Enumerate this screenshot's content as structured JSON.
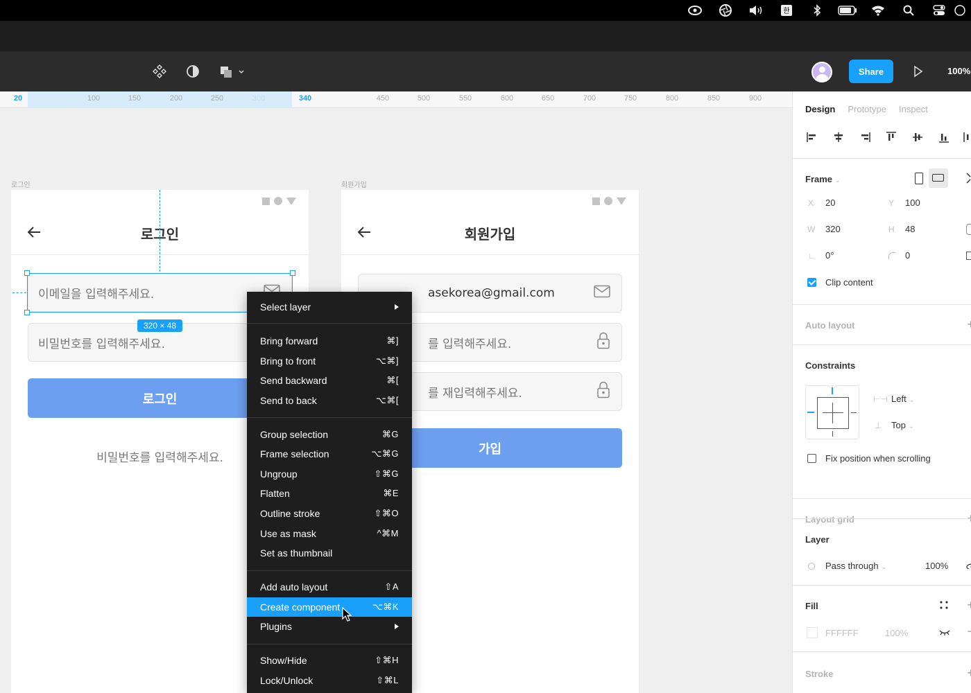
{
  "toolbar": {
    "share_label": "Share",
    "zoom": "100%"
  },
  "ruler": {
    "ticks": [
      {
        "label": "20",
        "style": "blue"
      },
      {
        "label": "100",
        "style": "normal"
      },
      {
        "label": "150",
        "style": "normal"
      },
      {
        "label": "200",
        "style": "normal"
      },
      {
        "label": "250",
        "style": "normal"
      },
      {
        "label": "300",
        "style": "faint"
      },
      {
        "label": "340",
        "style": "blue"
      },
      {
        "label": "450",
        "style": "normal"
      },
      {
        "label": "500",
        "style": "normal"
      },
      {
        "label": "550",
        "style": "normal"
      },
      {
        "label": "600",
        "style": "normal"
      },
      {
        "label": "650",
        "style": "normal"
      },
      {
        "label": "700",
        "style": "normal"
      },
      {
        "label": "750",
        "style": "normal"
      },
      {
        "label": "800",
        "style": "normal"
      },
      {
        "label": "850",
        "style": "normal"
      },
      {
        "label": "900",
        "style": "normal"
      }
    ]
  },
  "login_frame": {
    "label": "로그인",
    "title": "로그인",
    "email_placeholder": "이메일을 입력해주세요.",
    "password_placeholder": "비밀번호를 입력해주세요.",
    "button": "로그인",
    "helper": "비밀번호를 입력해주세요."
  },
  "signup_frame": {
    "label": "회원가입",
    "title": "회원가입",
    "email_value": "asekorea@gmail.com",
    "password_placeholder": "를 입력해주세요.",
    "password_confirm_placeholder": "를 재입력해주세요.",
    "button": "가입"
  },
  "selection": {
    "size": "320 × 48"
  },
  "context_menu": {
    "select_layer": "Select layer",
    "items": [
      {
        "label": "Bring forward",
        "shortcut": "⌘]"
      },
      {
        "label": "Bring to front",
        "shortcut": "⌥⌘]"
      },
      {
        "label": "Send backward",
        "shortcut": "⌘["
      },
      {
        "label": "Send to back",
        "shortcut": "⌥⌘["
      },
      {
        "label": "Group selection",
        "shortcut": "⌘G"
      },
      {
        "label": "Frame selection",
        "shortcut": "⌥⌘G"
      },
      {
        "label": "Ungroup",
        "shortcut": "⇧⌘G"
      },
      {
        "label": "Flatten",
        "shortcut": "⌘E"
      },
      {
        "label": "Outline stroke",
        "shortcut": "⇧⌘O"
      },
      {
        "label": "Use as mask",
        "shortcut": "^⌘M"
      },
      {
        "label": "Set as thumbnail",
        "shortcut": ""
      },
      {
        "label": "Add auto layout",
        "shortcut": "⇧A"
      },
      {
        "label": "Create component",
        "shortcut": "⌥⌘K",
        "highlighted": true
      },
      {
        "label": "Plugins",
        "shortcut": ""
      },
      {
        "label": "Show/Hide",
        "shortcut": "⇧⌘H"
      },
      {
        "label": "Lock/Unlock",
        "shortcut": "⇧⌘L"
      }
    ]
  },
  "panel": {
    "tabs": [
      "Design",
      "Prototype",
      "Inspect"
    ],
    "frame": {
      "title": "Frame",
      "x_label": "X",
      "x": "20",
      "y_label": "Y",
      "y": "100",
      "w_label": "W",
      "w": "320",
      "h_label": "H",
      "h": "48",
      "rotation": "0°",
      "radius": "0",
      "clip_content": "Clip content"
    },
    "auto_layout": "Auto layout",
    "constraints": {
      "title": "Constraints",
      "horizontal": "Left",
      "vertical": "Top",
      "fix_position": "Fix position when scrolling"
    },
    "layout_grid": "Layout grid",
    "layer": {
      "title": "Layer",
      "blend": "Pass through",
      "opacity": "100%"
    },
    "fill": {
      "title": "Fill",
      "hex": "FFFFFF",
      "opacity": "100%"
    },
    "stroke": "Stroke"
  },
  "colors": {
    "accent": "#18a0fb",
    "button": "#6d9ff0",
    "menu_bg": "#1e1e1e"
  }
}
